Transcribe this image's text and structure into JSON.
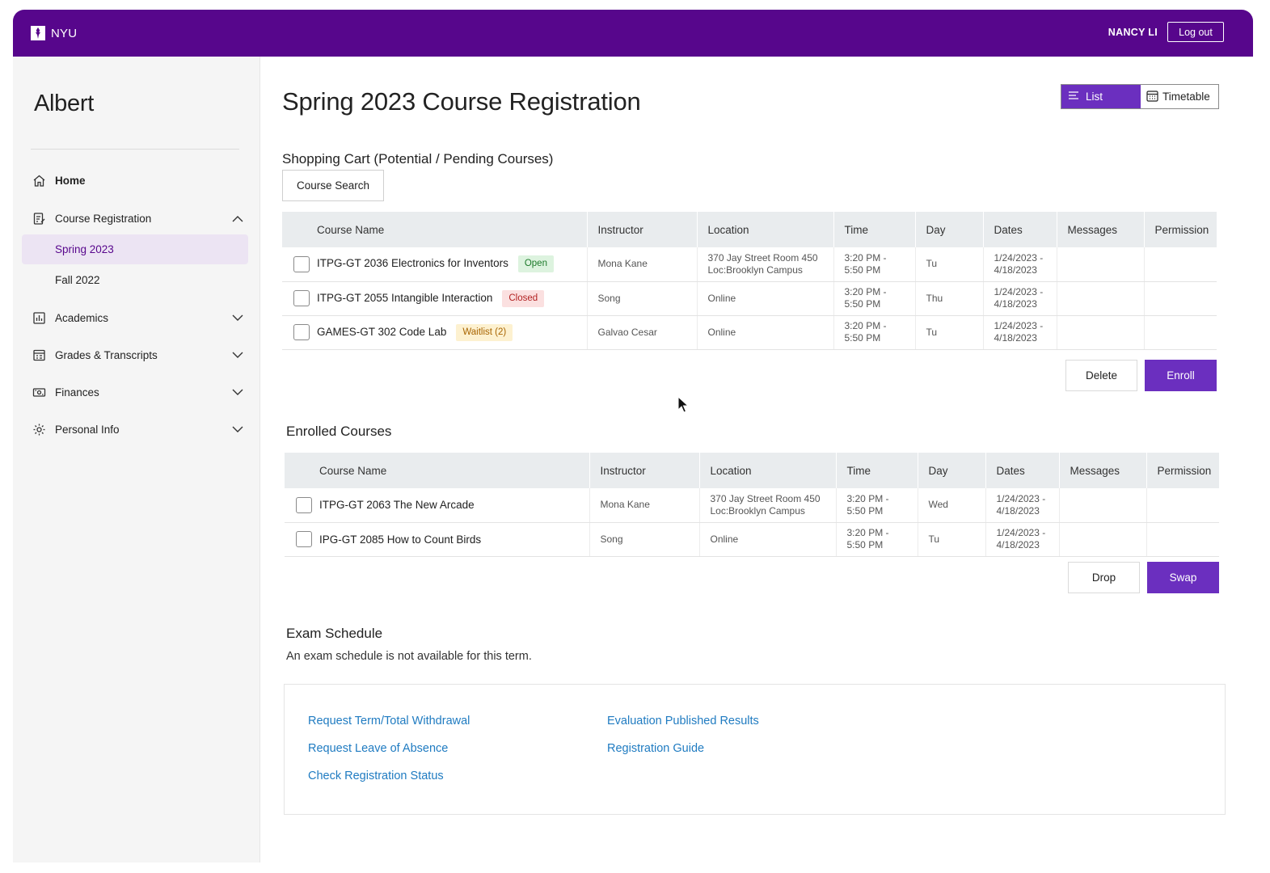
{
  "topbar": {
    "logo_text": "NYU",
    "user_name": "NANCY LI",
    "logout_label": "Log out"
  },
  "sidebar": {
    "brand": "Albert",
    "items": [
      {
        "label": "Home",
        "icon": "home-icon"
      },
      {
        "label": "Course Registration",
        "icon": "registration-icon",
        "expanded": true
      },
      {
        "label": "Academics",
        "icon": "academics-icon"
      },
      {
        "label": "Grades & Transcripts",
        "icon": "grades-icon"
      },
      {
        "label": "Finances",
        "icon": "finances-icon"
      },
      {
        "label": "Personal Info",
        "icon": "settings-icon"
      }
    ],
    "sub_items": [
      {
        "label": "Spring 2023",
        "active": true
      },
      {
        "label": "Fall 2022",
        "active": false
      }
    ]
  },
  "main": {
    "title": "Spring 2023 Course Registration",
    "view_toggle": {
      "list_label": "List",
      "timetable_label": "Timetable",
      "selected": "List"
    },
    "cart": {
      "heading": "Shopping Cart (Potential / Pending Courses)",
      "search_label": "Course Search",
      "columns": [
        "",
        "Course Name",
        "Instructor",
        "Location",
        "Time",
        "Day",
        "Dates",
        "Messages",
        "Permission"
      ],
      "rows": [
        {
          "course": "ITPG-GT 2036 Electronics for Inventors",
          "status": "Open",
          "status_type": "open",
          "instructor": "Mona Kane",
          "location_1": "370 Jay Street Room 450",
          "location_2": "Loc:Brooklyn Campus",
          "time_1": "3:20 PM -",
          "time_2": "5:50 PM",
          "day": "Tu",
          "dates_1": "1/24/2023 -",
          "dates_2": "4/18/2023",
          "messages": "",
          "permission": ""
        },
        {
          "course": "ITPG-GT 2055 Intangible Interaction",
          "status": "Closed",
          "status_type": "closed",
          "instructor": "Song",
          "location_1": "Online",
          "location_2": "",
          "time_1": "3:20 PM -",
          "time_2": "5:50 PM",
          "day": "Thu",
          "dates_1": "1/24/2023 -",
          "dates_2": "4/18/2023",
          "messages": "",
          "permission": ""
        },
        {
          "course": "GAMES-GT 302 Code Lab",
          "status": "Waitlist (2)",
          "status_type": "wait",
          "instructor": "Galvao Cesar",
          "location_1": "Online",
          "location_2": "",
          "time_1": "3:20 PM -",
          "time_2": "5:50 PM",
          "day": "Tu",
          "dates_1": "1/24/2023 -",
          "dates_2": "4/18/2023",
          "messages": "",
          "permission": ""
        }
      ],
      "delete_label": "Delete",
      "enroll_label": "Enroll"
    },
    "enrolled": {
      "heading": "Enrolled Courses",
      "columns": [
        "",
        "Course Name",
        "Instructor",
        "Location",
        "Time",
        "Day",
        "Dates",
        "Messages",
        "Permission"
      ],
      "rows": [
        {
          "course": "ITPG-GT 2063 The New Arcade",
          "instructor": "Mona Kane",
          "location_1": "370 Jay Street Room 450",
          "location_2": "Loc:Brooklyn Campus",
          "time_1": "3:20 PM -",
          "time_2": "5:50 PM",
          "day": "Wed",
          "dates_1": "1/24/2023 -",
          "dates_2": "4/18/2023",
          "messages": "",
          "permission": ""
        },
        {
          "course": "IPG-GT 2085 How to Count Birds",
          "instructor": "Song",
          "location_1": "Online",
          "location_2": "",
          "time_1": "3:20 PM -",
          "time_2": "5:50 PM",
          "day": "Tu",
          "dates_1": "1/24/2023 -",
          "dates_2": "4/18/2023",
          "messages": "",
          "permission": ""
        }
      ],
      "drop_label": "Drop",
      "swap_label": "Swap"
    },
    "exam": {
      "heading": "Exam Schedule",
      "note": "An exam schedule is not available for this term."
    },
    "links": {
      "left": [
        "Request Term/Total Withdrawal",
        "Request Leave of Absence",
        "Check Registration Status"
      ],
      "right": [
        "Evaluation Published Results",
        "Registration Guide"
      ]
    }
  },
  "colors": {
    "brand_purple": "#57068c",
    "accent_purple": "#6b2fbf",
    "link_blue": "#1f7bc1"
  }
}
